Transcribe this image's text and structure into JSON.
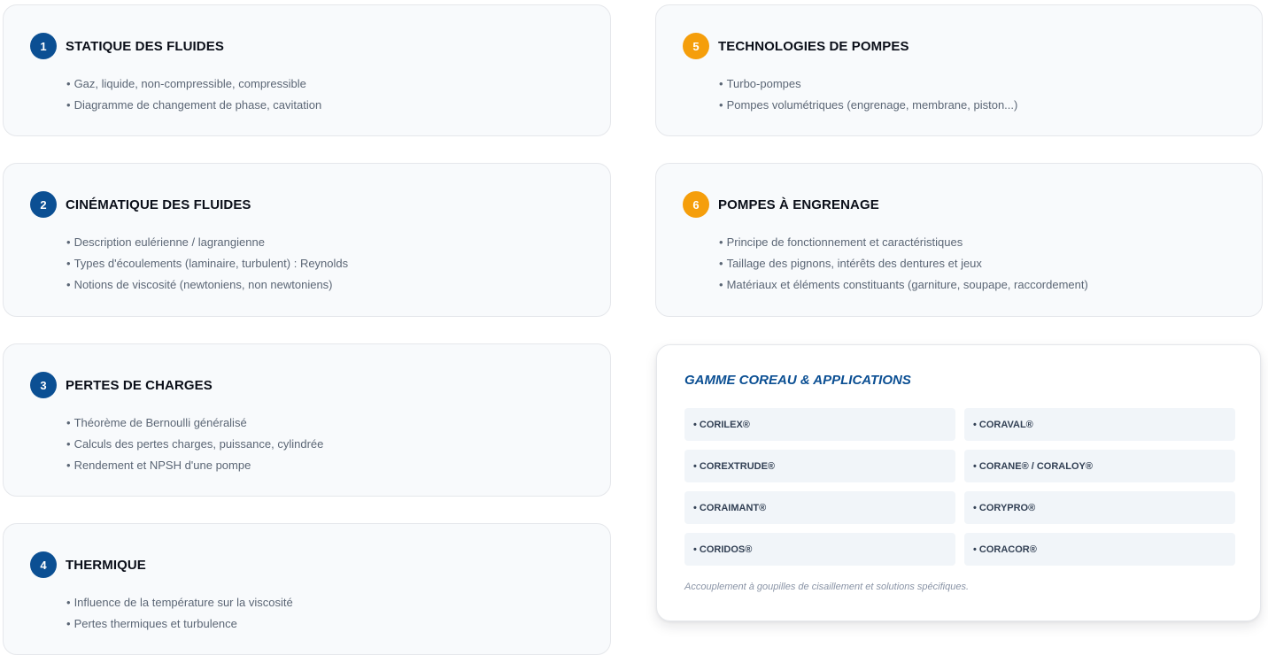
{
  "modules": [
    {
      "number": "1",
      "title": "STATIQUE DES FLUIDES",
      "badge_color": "#0b4f93",
      "bullets": [
        "Gaz, liquide, non-compressible, compressible",
        "Diagramme de changement de phase, cavitation"
      ]
    },
    {
      "number": "2",
      "title": "CINÉMATIQUE DES FLUIDES",
      "badge_color": "#0b4f93",
      "bullets": [
        "Description eulérienne / lagrangienne",
        "Types d'écoulements (laminaire, turbulent) : Reynolds",
        "Notions de viscosité (newtoniens, non newtoniens)"
      ]
    },
    {
      "number": "3",
      "title": "PERTES DE CHARGES",
      "badge_color": "#0b4f93",
      "bullets": [
        "Théorème de Bernoulli généralisé",
        "Calculs des pertes charges, puissance, cylindrée",
        "Rendement et NPSH d'une pompe"
      ]
    },
    {
      "number": "4",
      "title": "THERMIQUE",
      "badge_color": "#0b4f93",
      "bullets": [
        "Influence de la température sur la viscosité",
        "Pertes thermiques et turbulence"
      ]
    },
    {
      "number": "5",
      "title": "TECHNOLOGIES DE POMPES",
      "badge_color": "#f59e0b",
      "bullets": [
        "Turbo-pompes",
        "Pompes volumétriques (engrenage, membrane, piston...)"
      ]
    },
    {
      "number": "6",
      "title": "POMPES À ENGRENAGE",
      "badge_color": "#f59e0b",
      "bullets": [
        "Principe de fonctionnement et caractéristiques",
        "Taillage des pignons, intérêts des dentures et jeux",
        "Matériaux et éléments constituants (garniture, soupape, raccordement)"
      ]
    }
  ],
  "bullet_glyph": "•",
  "gamme": {
    "title": "GAMME COREAU & APPLICATIONS",
    "products": [
      "• CORILEX®",
      "• CORAVAL®",
      "• COREXTRUDE®",
      "• CORANE® / CORALOY®",
      "• CORAIMANT®",
      "• CORYPRO®",
      "• CORIDOS®",
      "• CORACOR®"
    ],
    "note": "Accouplement à goupilles de cisaillement et solutions spécifiques."
  }
}
